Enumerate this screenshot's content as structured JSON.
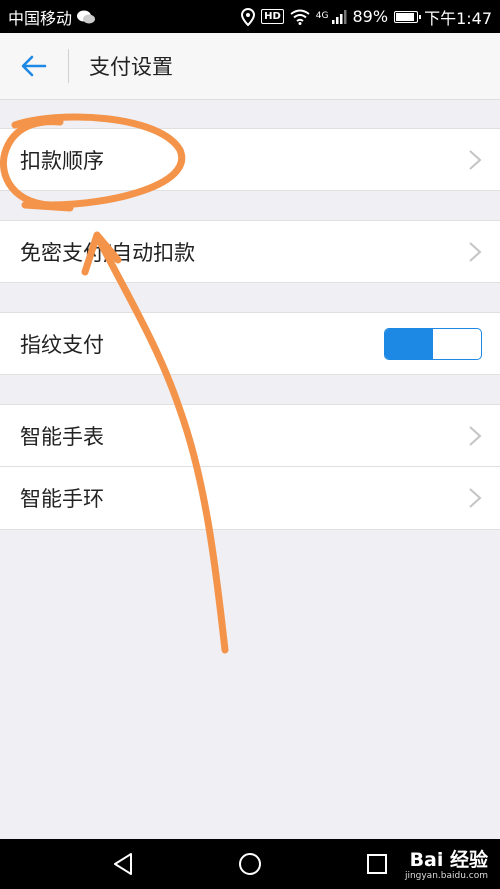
{
  "status": {
    "carrier": "中国移动",
    "hd": "HD",
    "network": "4G",
    "battery_percent": "89%",
    "battery_level": 0.89,
    "time": "下午1:47"
  },
  "header": {
    "title": "支付设置"
  },
  "settings": {
    "groups": [
      {
        "items": [
          {
            "label": "扣款顺序"
          }
        ]
      },
      {
        "items": [
          {
            "label": "免密支付/自动扣款"
          }
        ]
      },
      {
        "items": [
          {
            "label": "指纹支付",
            "toggle_on": true
          }
        ]
      },
      {
        "items": [
          {
            "label": "智能手表"
          },
          {
            "label": "智能手环"
          }
        ]
      }
    ]
  },
  "watermark": {
    "brand": "Bai 经验",
    "url": "jingyan.baidu.com"
  },
  "colors": {
    "accent": "#1e88e5",
    "annotation": "#f4944a"
  }
}
